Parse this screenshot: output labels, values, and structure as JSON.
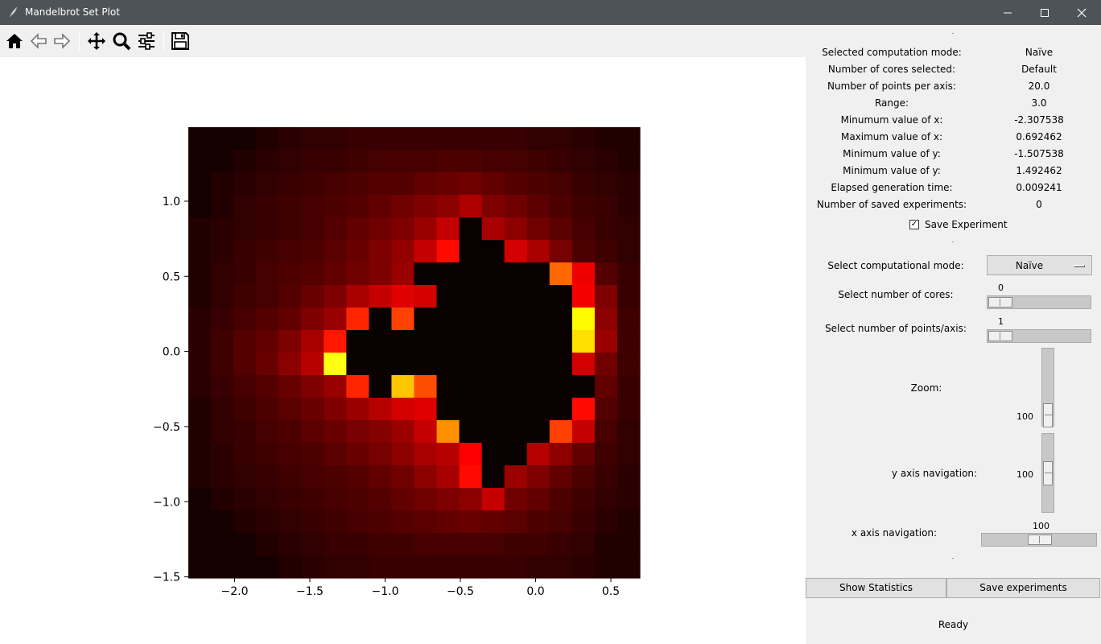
{
  "window": {
    "title": "Mandelbrot Set Plot",
    "controls": [
      "minimize-icon",
      "maximize-icon",
      "close-icon"
    ]
  },
  "toolbar": {
    "buttons": [
      "home-icon",
      "back-arrow-icon",
      "forward-arrow-icon",
      "pan-icon",
      "zoom-icon",
      "configure-subplots-icon",
      "save-icon"
    ]
  },
  "info": [
    {
      "label": "Selected computation mode:",
      "value": "Naïve"
    },
    {
      "label": "Number of cores selected:",
      "value": "Default"
    },
    {
      "label": "Number of points per axis:",
      "value": "20.0"
    },
    {
      "label": "Range:",
      "value": "3.0"
    },
    {
      "label": "Minumum value of x:",
      "value": "-2.307538"
    },
    {
      "label": "Maximum value of x:",
      "value": "0.692462"
    },
    {
      "label": "Minimum value of y:",
      "value": "-1.507538"
    },
    {
      "label": "Minimum value of y:",
      "value": "1.492462"
    },
    {
      "label": "Elapsed generation time:",
      "value": "0.009241"
    },
    {
      "label": "Number of saved experiments:",
      "value": "0"
    }
  ],
  "save_checkbox": {
    "label": "Save Experiment",
    "checked": true,
    "mark": "✓"
  },
  "controls": {
    "mode_label": "Select computational mode:",
    "mode_value": "Naïve",
    "cores_label": "Select number of cores:",
    "cores_value": "0",
    "points_label": "Select number of points/axis:",
    "points_value": "1",
    "zoom_label": "Zoom:",
    "zoom_value": "100",
    "ynav_label": "y axis navigation:",
    "ynav_value": "100",
    "xnav_label": "x axis navigation:",
    "xnav_value": "100"
  },
  "buttons": {
    "show_statistics": "Show Statistics",
    "save_experiments": "Save experiments"
  },
  "status": "Ready",
  "chart_data": {
    "type": "heatmap",
    "title": "",
    "xlabel": "",
    "ylabel": "",
    "xlim": [
      -2.307538,
      0.692462
    ],
    "ylim": [
      -1.507538,
      1.492462
    ],
    "x_ticks": [
      -2.0,
      -1.5,
      -1.0,
      -0.5,
      0.0,
      0.5
    ],
    "x_tick_labels": [
      "−2.0",
      "−1.5",
      "−1.0",
      "−0.5",
      "0.0",
      "0.5"
    ],
    "y_ticks": [
      1.0,
      0.5,
      0.0,
      -0.5,
      -1.0,
      -1.5
    ],
    "y_tick_labels": [
      "1.0",
      "0.5",
      "0.0",
      "−0.5",
      "−1.0",
      "−1.5"
    ],
    "colormap": "hot",
    "grid": false,
    "grid_size": [
      20,
      20
    ],
    "values": [
      [
        0.03,
        0.03,
        0.03,
        0.05,
        0.06,
        0.07,
        0.07,
        0.08,
        0.08,
        0.08,
        0.08,
        0.08,
        0.08,
        0.08,
        0.08,
        0.07,
        0.07,
        0.06,
        0.05,
        0.05
      ],
      [
        0.03,
        0.03,
        0.05,
        0.06,
        0.07,
        0.08,
        0.08,
        0.09,
        0.1,
        0.1,
        0.1,
        0.11,
        0.11,
        0.1,
        0.1,
        0.09,
        0.08,
        0.07,
        0.06,
        0.05
      ],
      [
        0.03,
        0.05,
        0.06,
        0.07,
        0.08,
        0.09,
        0.1,
        0.11,
        0.12,
        0.12,
        0.14,
        0.15,
        0.16,
        0.14,
        0.12,
        0.11,
        0.1,
        0.08,
        0.07,
        0.06
      ],
      [
        0.03,
        0.05,
        0.07,
        0.08,
        0.09,
        0.1,
        0.11,
        0.12,
        0.14,
        0.16,
        0.18,
        0.2,
        0.25,
        0.18,
        0.16,
        0.13,
        0.11,
        0.09,
        0.08,
        0.06
      ],
      [
        0.05,
        0.06,
        0.07,
        0.08,
        0.09,
        0.1,
        0.12,
        0.14,
        0.16,
        0.18,
        0.22,
        0.28,
        1.0,
        0.24,
        0.2,
        0.16,
        0.13,
        0.1,
        0.08,
        0.07
      ],
      [
        0.05,
        0.06,
        0.08,
        0.09,
        0.1,
        0.11,
        0.13,
        0.15,
        0.18,
        0.21,
        0.28,
        0.38,
        1.0,
        1.0,
        0.3,
        0.24,
        0.17,
        0.11,
        0.09,
        0.07
      ],
      [
        0.05,
        0.07,
        0.08,
        0.1,
        0.11,
        0.12,
        0.14,
        0.16,
        0.18,
        0.22,
        1.0,
        1.0,
        1.0,
        1.0,
        1.0,
        1.0,
        0.52,
        0.34,
        0.12,
        0.08
      ],
      [
        0.05,
        0.07,
        0.09,
        0.1,
        0.12,
        0.15,
        0.18,
        0.24,
        0.28,
        0.32,
        0.3,
        1.0,
        1.0,
        1.0,
        1.0,
        1.0,
        1.0,
        0.35,
        0.18,
        0.08
      ],
      [
        0.06,
        0.08,
        0.1,
        0.12,
        0.14,
        0.18,
        0.22,
        0.42,
        1.0,
        0.46,
        1.0,
        1.0,
        1.0,
        1.0,
        1.0,
        1.0,
        1.0,
        0.74,
        0.2,
        0.09
      ],
      [
        0.06,
        0.09,
        0.12,
        0.14,
        0.18,
        0.24,
        0.4,
        1.0,
        1.0,
        1.0,
        1.0,
        1.0,
        1.0,
        1.0,
        1.0,
        1.0,
        1.0,
        0.7,
        0.22,
        0.09
      ],
      [
        0.06,
        0.09,
        0.12,
        0.15,
        0.2,
        0.26,
        0.76,
        1.0,
        1.0,
        1.0,
        1.0,
        1.0,
        1.0,
        1.0,
        1.0,
        1.0,
        1.0,
        0.3,
        0.16,
        0.09
      ],
      [
        0.06,
        0.08,
        0.1,
        0.12,
        0.15,
        0.18,
        0.22,
        0.42,
        1.0,
        0.66,
        0.48,
        1.0,
        1.0,
        1.0,
        1.0,
        1.0,
        1.0,
        1.0,
        0.14,
        0.08
      ],
      [
        0.05,
        0.07,
        0.09,
        0.11,
        0.13,
        0.15,
        0.18,
        0.22,
        0.26,
        0.3,
        0.32,
        1.0,
        1.0,
        1.0,
        1.0,
        1.0,
        1.0,
        0.38,
        0.12,
        0.08
      ],
      [
        0.05,
        0.07,
        0.08,
        0.1,
        0.11,
        0.13,
        0.15,
        0.17,
        0.19,
        0.22,
        0.28,
        0.58,
        1.0,
        1.0,
        1.0,
        1.0,
        0.46,
        0.28,
        0.1,
        0.07
      ],
      [
        0.05,
        0.06,
        0.08,
        0.09,
        0.1,
        0.11,
        0.13,
        0.15,
        0.17,
        0.2,
        0.24,
        0.26,
        0.36,
        1.0,
        1.0,
        0.26,
        0.2,
        0.14,
        0.09,
        0.07
      ],
      [
        0.05,
        0.06,
        0.07,
        0.08,
        0.09,
        0.1,
        0.11,
        0.12,
        0.14,
        0.16,
        0.2,
        0.24,
        0.38,
        1.0,
        0.22,
        0.18,
        0.14,
        0.11,
        0.08,
        0.06
      ],
      [
        0.03,
        0.05,
        0.06,
        0.07,
        0.08,
        0.09,
        0.1,
        0.11,
        0.12,
        0.14,
        0.16,
        0.18,
        0.2,
        0.28,
        0.16,
        0.14,
        0.11,
        0.09,
        0.07,
        0.06
      ],
      [
        0.03,
        0.03,
        0.05,
        0.06,
        0.07,
        0.08,
        0.09,
        0.1,
        0.11,
        0.12,
        0.13,
        0.14,
        0.15,
        0.14,
        0.13,
        0.11,
        0.1,
        0.08,
        0.06,
        0.05
      ],
      [
        0.03,
        0.03,
        0.03,
        0.05,
        0.06,
        0.07,
        0.08,
        0.08,
        0.09,
        0.09,
        0.1,
        0.1,
        0.1,
        0.1,
        0.09,
        0.09,
        0.08,
        0.07,
        0.05,
        0.05
      ],
      [
        0.03,
        0.03,
        0.03,
        0.03,
        0.05,
        0.06,
        0.07,
        0.07,
        0.08,
        0.08,
        0.08,
        0.08,
        0.08,
        0.08,
        0.08,
        0.07,
        0.07,
        0.06,
        0.05,
        0.05
      ]
    ]
  }
}
